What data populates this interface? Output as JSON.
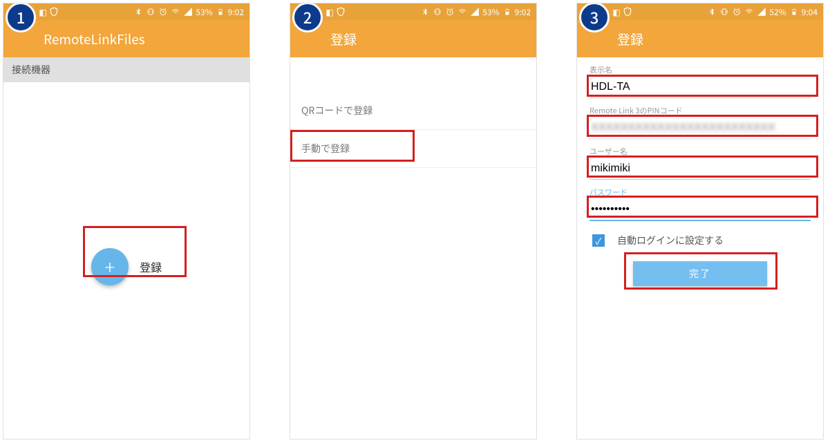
{
  "steps": [
    "1",
    "2",
    "3"
  ],
  "status": {
    "battery1": "53%",
    "time1": "9:02",
    "battery2": "53%",
    "time2": "9:02",
    "battery3": "52%",
    "time3": "9:04"
  },
  "screen1": {
    "title": "RemoteLinkFiles",
    "section": "接続機器",
    "register_label": "登録"
  },
  "screen2": {
    "title": "登録",
    "option_qr": "QRコードで登録",
    "option_manual": "手動で登録"
  },
  "screen3": {
    "title": "登録",
    "labels": {
      "display_name": "表示名",
      "pin": "Remote Link 3のPINコード",
      "username": "ユーザー名",
      "password": "パスワード"
    },
    "values": {
      "display_name": "HDL-TA",
      "pin": "XXXXXXXXXXXXXXXXXXXXXXXXX",
      "username": "mikimiki",
      "password": "••••••••••"
    },
    "autologin_label": "自動ログインに設定する",
    "done_label": "完了"
  }
}
